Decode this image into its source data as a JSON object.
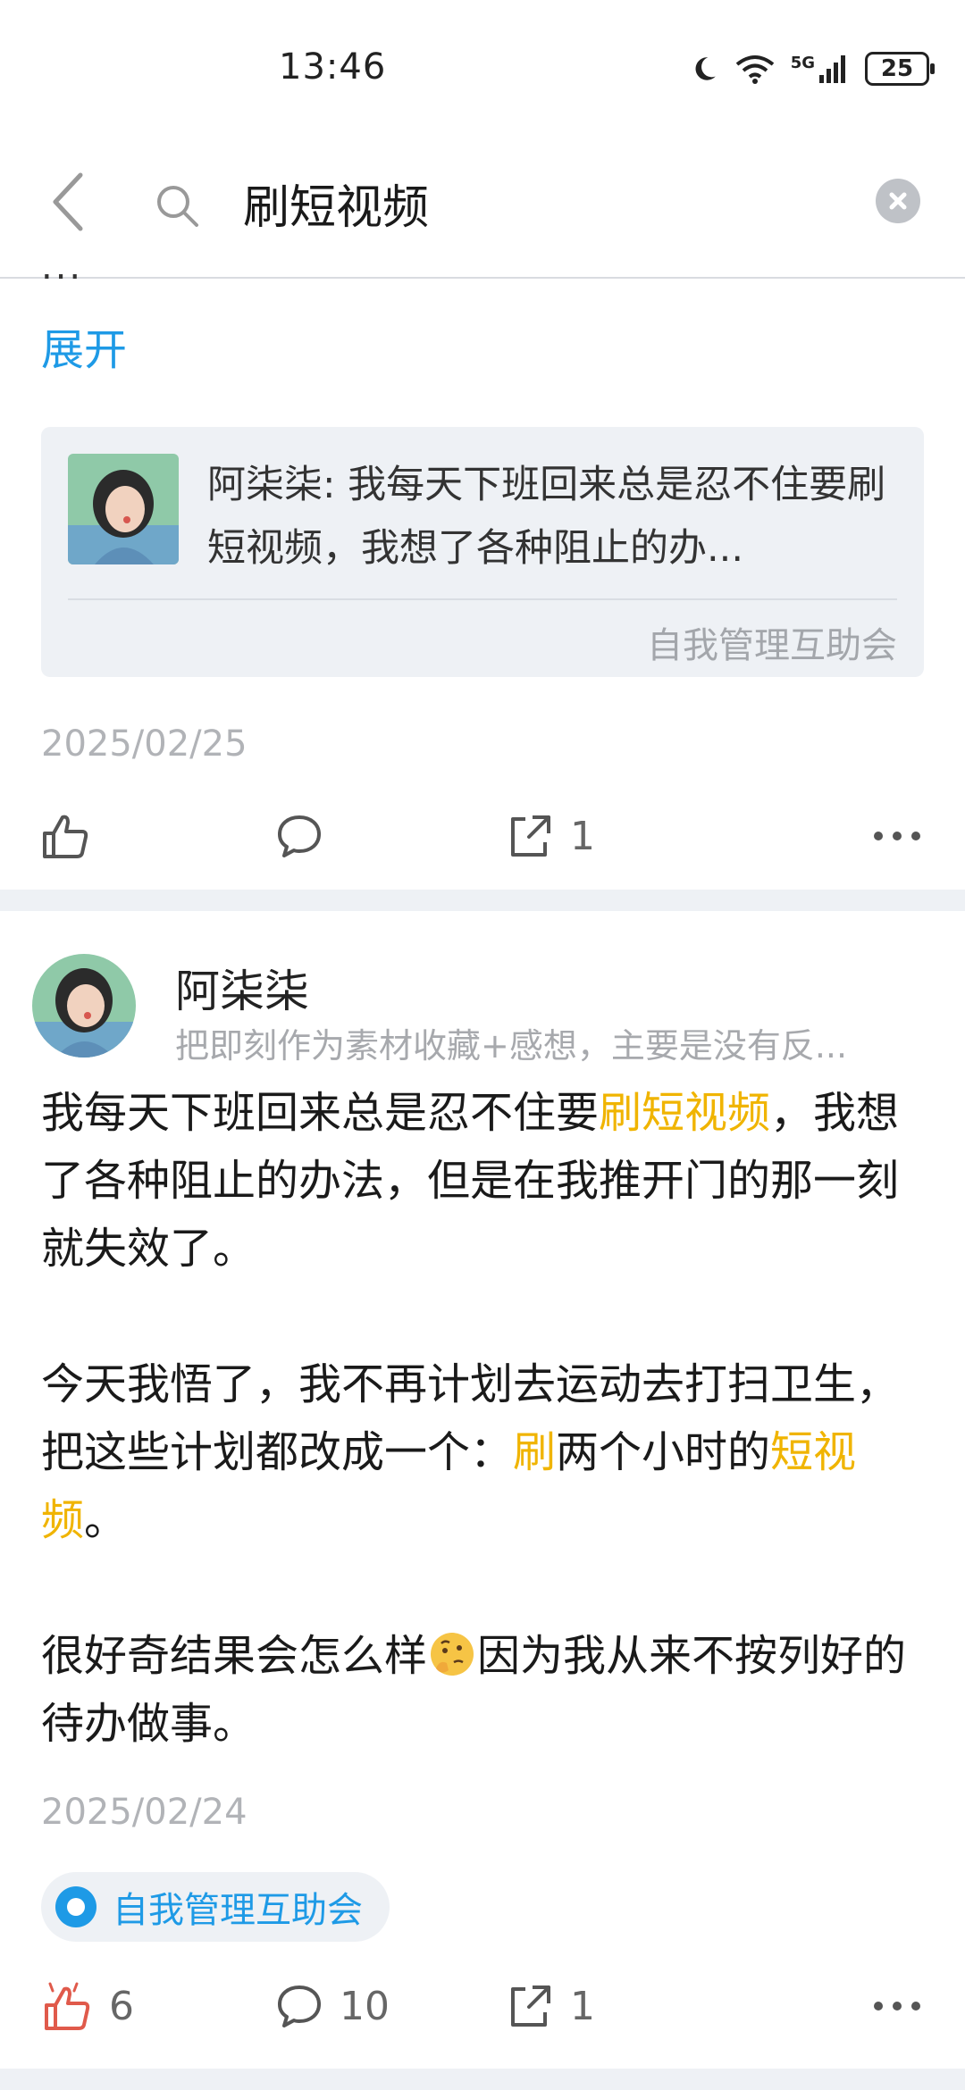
{
  "status_bar": {
    "time": "13:46",
    "network": "5G",
    "battery": "25"
  },
  "search": {
    "query": "刷短视频"
  },
  "previous_post": {
    "truncated": "...",
    "expand_label": "展开",
    "quote": {
      "text": "阿柒柒: 我每天下班回来总是忍不住要刷短视频，我想了各种阻止的办...",
      "source": "自我管理互助会"
    },
    "date": "2025/02/25",
    "actions": {
      "share_count": "1"
    }
  },
  "post": {
    "author": "阿柒柒",
    "bio": "把即刻作为素材收藏+感想，主要是没有反...",
    "paragraph1": {
      "before": "我每天下班回来总是忍不住要",
      "highlight": "刷短视频",
      "after": "，我想了各种阻止的办法，但是在我推开门的那一刻就失效了。"
    },
    "paragraph2": {
      "before": "今天我悟了，我不再计划去运动去打扫卫生，把这些计划都改成一个：",
      "highlight1": "刷",
      "middle": "两个小时的",
      "highlight2": "短视频",
      "after": "。"
    },
    "paragraph3": {
      "before": "很好奇结果会怎么样",
      "emoji": "thinking-face",
      "after": "因为我从来不按列好的待办做事。"
    },
    "date": "2025/02/24",
    "topic": "自我管理互助会",
    "actions": {
      "like_count": "6",
      "comment_count": "10",
      "share_count": "1"
    }
  },
  "colors": {
    "accent": "#1e9ae6",
    "highlight": "#f0b400",
    "like_active": "#e05a4b"
  }
}
